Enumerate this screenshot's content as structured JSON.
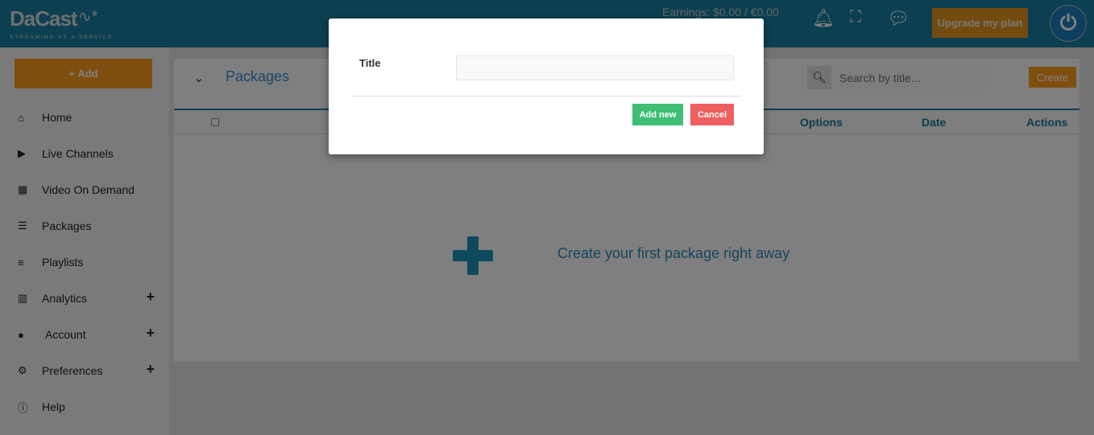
{
  "header": {
    "logo": "DaCast",
    "tagline": "STREAMING AS A SERVICE",
    "earnings": "Earnings: $0.00 / €0.00",
    "upgrade_label": "Upgrade my plan"
  },
  "sidebar": {
    "add_label": "+ Add",
    "items": [
      {
        "label": "Home",
        "icon": "home-icon"
      },
      {
        "label": "Live Channels",
        "icon": "play-circle-icon"
      },
      {
        "label": "Video On Demand",
        "icon": "film-icon"
      },
      {
        "label": "Packages",
        "icon": "indent-list-icon"
      },
      {
        "label": "Playlists",
        "icon": "playlist-add-icon"
      },
      {
        "label": "Analytics",
        "icon": "bar-chart-icon",
        "expandable": true
      },
      {
        "label": "Account",
        "icon": "user-icon",
        "expandable": true
      },
      {
        "label": "Preferences",
        "icon": "gear-icon",
        "expandable": true
      },
      {
        "label": "Help",
        "icon": "info-icon"
      }
    ]
  },
  "main": {
    "title": "Packages",
    "search_placeholder": "Search by title...",
    "create_label": "Create",
    "columns": [
      "Options",
      "Date",
      "Actions"
    ],
    "empty_message": "Create your first package right away"
  },
  "modal": {
    "title_label": "Title",
    "title_value": "",
    "add_label": "Add new",
    "cancel_label": "Cancel"
  },
  "colors": {
    "header": "#167fa2",
    "accent": "#fe9e20",
    "add_new": "#3fbf75",
    "cancel": "#ef5f5f"
  }
}
